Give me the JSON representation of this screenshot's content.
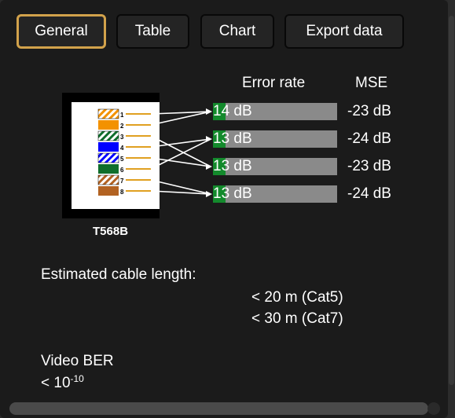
{
  "tabs": [
    {
      "label": "General",
      "active": true
    },
    {
      "label": "Table",
      "active": false
    },
    {
      "label": "Chart",
      "active": false
    },
    {
      "label": "Export data",
      "active": false
    }
  ],
  "columns": {
    "error_rate": "Error rate",
    "mse": "MSE"
  },
  "connector": {
    "label": "T568B",
    "pins": [
      "1",
      "2",
      "3",
      "4",
      "5",
      "6",
      "7",
      "8"
    ]
  },
  "pairs": [
    {
      "error_rate": "14 dB",
      "fill_fraction": 0.1,
      "mse": "-23 dB"
    },
    {
      "error_rate": "13 dB",
      "fill_fraction": 0.1,
      "mse": "-24 dB"
    },
    {
      "error_rate": "13 dB",
      "fill_fraction": 0.1,
      "mse": "-23 dB"
    },
    {
      "error_rate": "13 dB",
      "fill_fraction": 0.1,
      "mse": "-24 dB"
    }
  ],
  "cable_length": {
    "label": "Estimated cable length:",
    "lines": [
      "< 20 m (Cat5)",
      "< 30 m (Cat7)"
    ]
  },
  "video_ber": {
    "title": "Video BER",
    "prefix": "< 10",
    "exponent": "-10"
  },
  "colors": {
    "accent_border": "#d2a24b",
    "bar_fill": "#138a2c",
    "bar_bg": "#8a8a8a",
    "wire_orange": "#f39200",
    "wire_green": "#0f6e2c",
    "wire_blue": "#0000ff",
    "wire_brown": "#b26222"
  }
}
